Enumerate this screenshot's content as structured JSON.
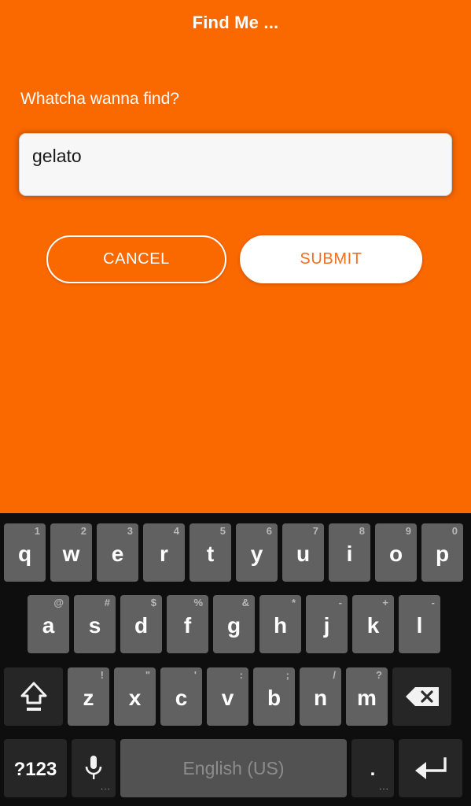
{
  "app": {
    "title": "Find Me ...",
    "prompt_label": "Whatcha wanna find?",
    "accent_color": "#fa6800",
    "search": {
      "value": "gelato",
      "placeholder": "Whatcha wanna find?"
    },
    "buttons": {
      "cancel": "CANCEL",
      "submit": "SUBMIT"
    }
  },
  "keyboard": {
    "language": "English (US)",
    "symbols_key": "?123",
    "period_key": ".",
    "dots": "···",
    "rows": [
      [
        {
          "main": "q",
          "hint": "1"
        },
        {
          "main": "w",
          "hint": "2"
        },
        {
          "main": "e",
          "hint": "3"
        },
        {
          "main": "r",
          "hint": "4"
        },
        {
          "main": "t",
          "hint": "5"
        },
        {
          "main": "y",
          "hint": "6"
        },
        {
          "main": "u",
          "hint": "7"
        },
        {
          "main": "i",
          "hint": "8"
        },
        {
          "main": "o",
          "hint": "9"
        },
        {
          "main": "p",
          "hint": "0"
        }
      ],
      [
        {
          "main": "a",
          "hint": "@"
        },
        {
          "main": "s",
          "hint": "#"
        },
        {
          "main": "d",
          "hint": "$"
        },
        {
          "main": "f",
          "hint": "%"
        },
        {
          "main": "g",
          "hint": "&"
        },
        {
          "main": "h",
          "hint": "*"
        },
        {
          "main": "j",
          "hint": "-"
        },
        {
          "main": "k",
          "hint": "+"
        },
        {
          "main": "l",
          "hint": "-"
        }
      ],
      [
        {
          "main": "z",
          "hint": "!"
        },
        {
          "main": "x",
          "hint": "\""
        },
        {
          "main": "c",
          "hint": "'"
        },
        {
          "main": "v",
          "hint": ":"
        },
        {
          "main": "b",
          "hint": ";"
        },
        {
          "main": "n",
          "hint": "/"
        },
        {
          "main": "m",
          "hint": "?"
        }
      ]
    ]
  }
}
